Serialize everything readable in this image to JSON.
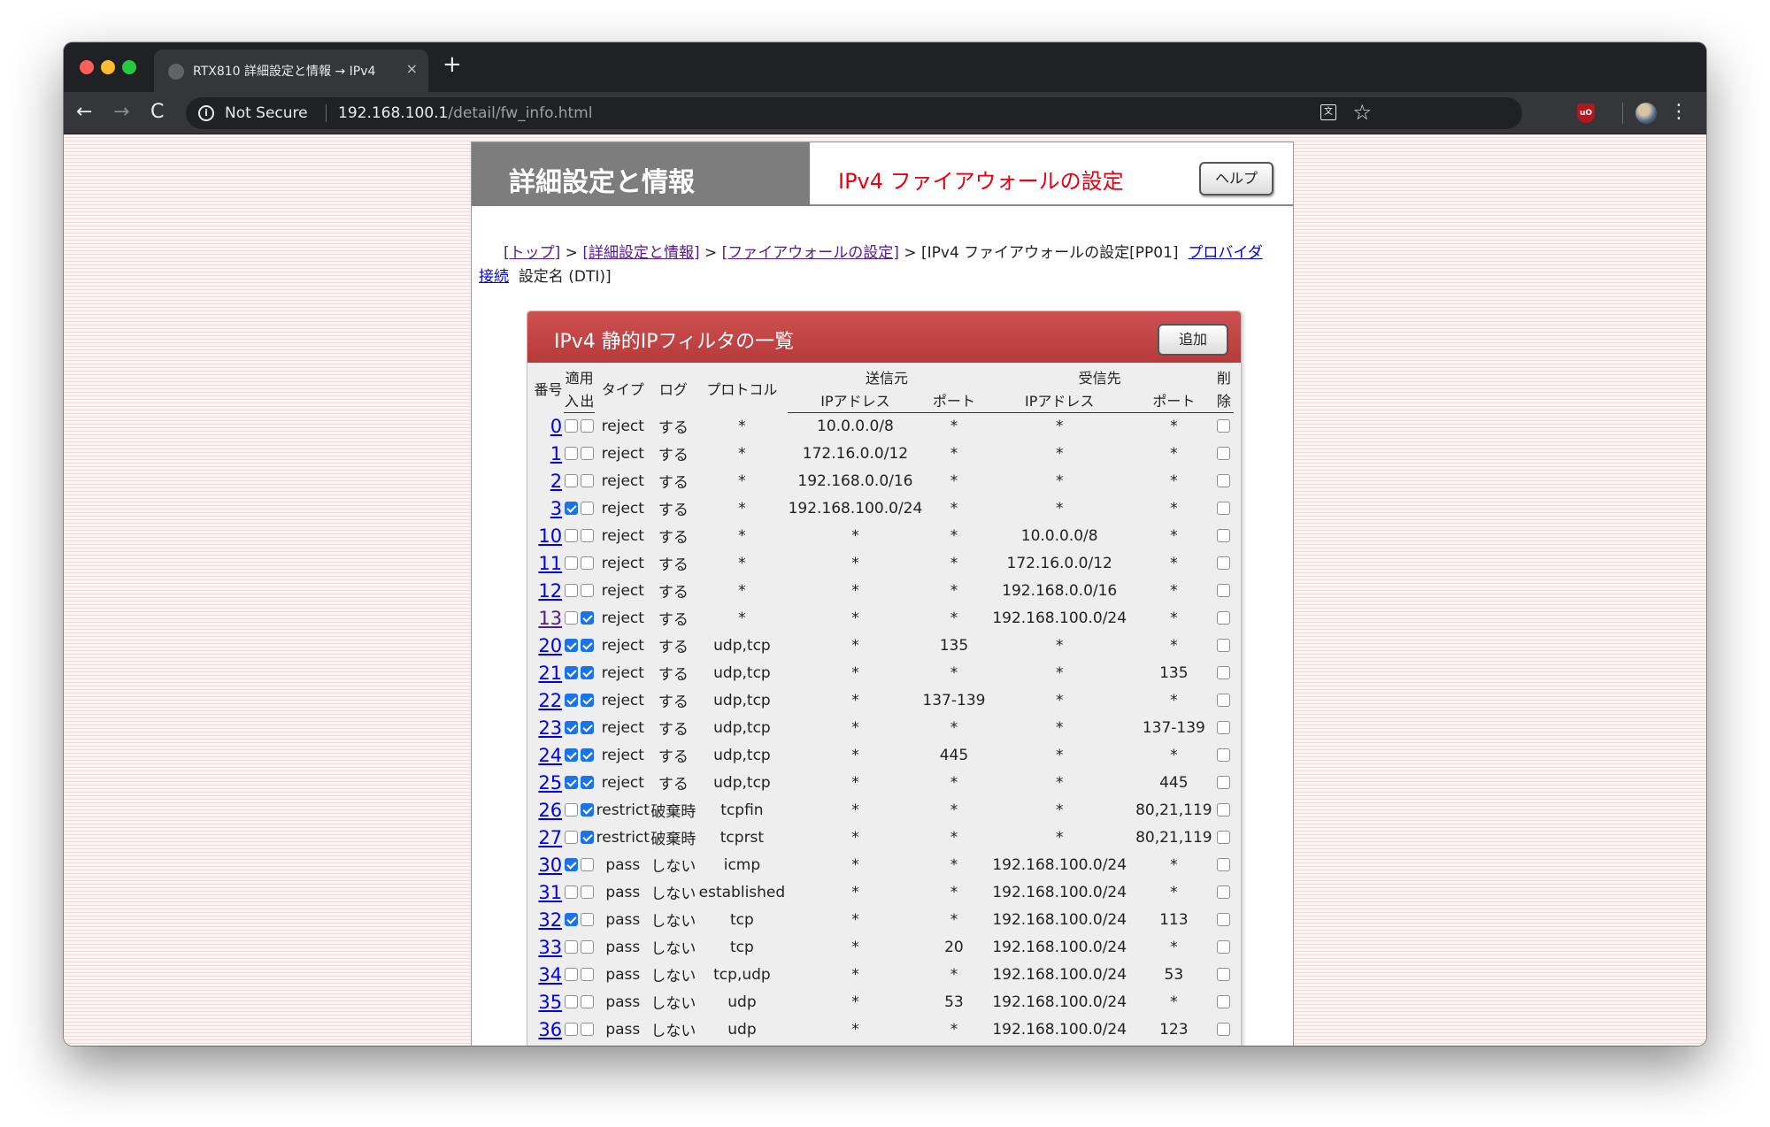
{
  "browser": {
    "tab_title": "RTX810 詳細設定と情報 → IPv4",
    "tab_close": "×",
    "new_tab": "+",
    "back": "←",
    "forward": "→",
    "reload": "C",
    "security_label": "Not Secure",
    "url_host": "192.168.100.1",
    "url_path": "/detail/fw_info.html",
    "star": "☆",
    "menu": "⋮"
  },
  "header": {
    "left_title": "詳細設定と情報",
    "right_title": "IPv4 ファイアウォールの設定",
    "help_label": "ヘルプ"
  },
  "breadcrumb": {
    "top": "[トップ]",
    "sep": " > ",
    "detail": "[詳細設定と情報]",
    "firewall": "[ファイアウォールの設定]",
    "current": "[IPv4 ファイアウォールの設定[PP01]",
    "provider_a": "プロバイダ",
    "provider_b": "接続",
    "setting_name": "設定名 (DTI)]"
  },
  "panel": {
    "title": "IPv4 静的IPフィルタの一覧",
    "add_label": "追加"
  },
  "columns": {
    "number": "番号",
    "apply": "適用",
    "in": "入",
    "out": "出",
    "type": "タイプ",
    "log": "ログ",
    "protocol": "プロトコル",
    "source": "送信元",
    "dest": "受信先",
    "ip": "IPアドレス",
    "port": "ポート",
    "delete_a": "削",
    "delete_b": "除"
  },
  "rows": [
    {
      "no": "0",
      "in": false,
      "out": false,
      "type": "reject",
      "log": "する",
      "proto": "*",
      "src_ip": "10.0.0.0/8",
      "src_port": "*",
      "dst_ip": "*",
      "dst_port": "*"
    },
    {
      "no": "1",
      "in": false,
      "out": false,
      "type": "reject",
      "log": "する",
      "proto": "*",
      "src_ip": "172.16.0.0/12",
      "src_port": "*",
      "dst_ip": "*",
      "dst_port": "*"
    },
    {
      "no": "2",
      "in": false,
      "out": false,
      "type": "reject",
      "log": "する",
      "proto": "*",
      "src_ip": "192.168.0.0/16",
      "src_port": "*",
      "dst_ip": "*",
      "dst_port": "*"
    },
    {
      "no": "3",
      "in": true,
      "out": false,
      "type": "reject",
      "log": "する",
      "proto": "*",
      "src_ip": "192.168.100.0/24",
      "src_port": "*",
      "dst_ip": "*",
      "dst_port": "*"
    },
    {
      "no": "10",
      "in": false,
      "out": false,
      "type": "reject",
      "log": "する",
      "proto": "*",
      "src_ip": "*",
      "src_port": "*",
      "dst_ip": "10.0.0.0/8",
      "dst_port": "*"
    },
    {
      "no": "11",
      "in": false,
      "out": false,
      "type": "reject",
      "log": "する",
      "proto": "*",
      "src_ip": "*",
      "src_port": "*",
      "dst_ip": "172.16.0.0/12",
      "dst_port": "*"
    },
    {
      "no": "12",
      "in": false,
      "out": false,
      "type": "reject",
      "log": "する",
      "proto": "*",
      "src_ip": "*",
      "src_port": "*",
      "dst_ip": "192.168.0.0/16",
      "dst_port": "*"
    },
    {
      "no": "13",
      "in": false,
      "out": true,
      "type": "reject",
      "log": "する",
      "proto": "*",
      "src_ip": "*",
      "src_port": "*",
      "dst_ip": "192.168.100.0/24",
      "dst_port": "*",
      "visited": true
    },
    {
      "no": "20",
      "in": true,
      "out": true,
      "type": "reject",
      "log": "する",
      "proto": "udp,tcp",
      "src_ip": "*",
      "src_port": "135",
      "dst_ip": "*",
      "dst_port": "*"
    },
    {
      "no": "21",
      "in": true,
      "out": true,
      "type": "reject",
      "log": "する",
      "proto": "udp,tcp",
      "src_ip": "*",
      "src_port": "*",
      "dst_ip": "*",
      "dst_port": "135"
    },
    {
      "no": "22",
      "in": true,
      "out": true,
      "type": "reject",
      "log": "する",
      "proto": "udp,tcp",
      "src_ip": "*",
      "src_port": "137-139",
      "dst_ip": "*",
      "dst_port": "*"
    },
    {
      "no": "23",
      "in": true,
      "out": true,
      "type": "reject",
      "log": "する",
      "proto": "udp,tcp",
      "src_ip": "*",
      "src_port": "*",
      "dst_ip": "*",
      "dst_port": "137-139"
    },
    {
      "no": "24",
      "in": true,
      "out": true,
      "type": "reject",
      "log": "する",
      "proto": "udp,tcp",
      "src_ip": "*",
      "src_port": "445",
      "dst_ip": "*",
      "dst_port": "*"
    },
    {
      "no": "25",
      "in": true,
      "out": true,
      "type": "reject",
      "log": "する",
      "proto": "udp,tcp",
      "src_ip": "*",
      "src_port": "*",
      "dst_ip": "*",
      "dst_port": "445"
    },
    {
      "no": "26",
      "in": false,
      "out": true,
      "type": "restrict",
      "log": "破棄時",
      "proto": "tcpfin",
      "src_ip": "*",
      "src_port": "*",
      "dst_ip": "*",
      "dst_port": "80,21,119"
    },
    {
      "no": "27",
      "in": false,
      "out": true,
      "type": "restrict",
      "log": "破棄時",
      "proto": "tcprst",
      "src_ip": "*",
      "src_port": "*",
      "dst_ip": "*",
      "dst_port": "80,21,119"
    },
    {
      "no": "30",
      "in": true,
      "out": false,
      "type": "pass",
      "log": "しない",
      "proto": "icmp",
      "src_ip": "*",
      "src_port": "*",
      "dst_ip": "192.168.100.0/24",
      "dst_port": "*"
    },
    {
      "no": "31",
      "in": false,
      "out": false,
      "type": "pass",
      "log": "しない",
      "proto": "established",
      "src_ip": "*",
      "src_port": "*",
      "dst_ip": "192.168.100.0/24",
      "dst_port": "*"
    },
    {
      "no": "32",
      "in": true,
      "out": false,
      "type": "pass",
      "log": "しない",
      "proto": "tcp",
      "src_ip": "*",
      "src_port": "*",
      "dst_ip": "192.168.100.0/24",
      "dst_port": "113"
    },
    {
      "no": "33",
      "in": false,
      "out": false,
      "type": "pass",
      "log": "しない",
      "proto": "tcp",
      "src_ip": "*",
      "src_port": "20",
      "dst_ip": "192.168.100.0/24",
      "dst_port": "*"
    },
    {
      "no": "34",
      "in": false,
      "out": false,
      "type": "pass",
      "log": "しない",
      "proto": "tcp,udp",
      "src_ip": "*",
      "src_port": "*",
      "dst_ip": "192.168.100.0/24",
      "dst_port": "53"
    },
    {
      "no": "35",
      "in": false,
      "out": false,
      "type": "pass",
      "log": "しない",
      "proto": "udp",
      "src_ip": "*",
      "src_port": "53",
      "dst_ip": "192.168.100.0/24",
      "dst_port": "*"
    },
    {
      "no": "36",
      "in": false,
      "out": false,
      "type": "pass",
      "log": "しない",
      "proto": "udp",
      "src_ip": "*",
      "src_port": "*",
      "dst_ip": "192.168.100.0/24",
      "dst_port": "123"
    }
  ]
}
